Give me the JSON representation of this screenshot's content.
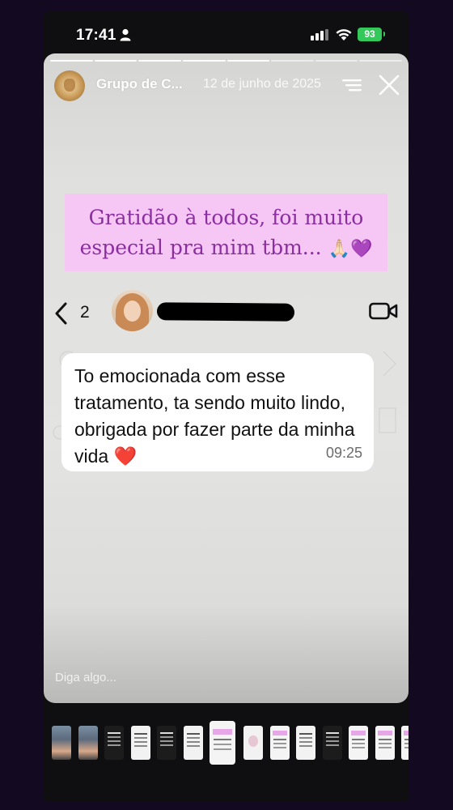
{
  "status_bar": {
    "time": "17:41",
    "battery": "93",
    "battery_color": "#34c759"
  },
  "story": {
    "user": "Grupo de C...",
    "date": "12 de junho de 2025",
    "caption_line1": "Gratidão à todos, foi muito",
    "caption_line2": "especial pra mim tbm...",
    "caption_emoji": "🙏🏻💜",
    "caption_bg": "#f6c7f4",
    "caption_color": "#8a2fa0",
    "reply_placeholder": "Diga algo...",
    "progress_total": 8,
    "progress_done": 5
  },
  "chat": {
    "unread_count": "2",
    "message": "To emocionada com esse tratamento, ta sendo muito lindo, obrigada por fazer parte da minha vida ❤️",
    "time": "09:25"
  },
  "icons": {
    "person": "person-icon",
    "signal": "cellular-signal-icon",
    "wifi": "wifi-icon",
    "menu": "menu-icon",
    "close": "close-icon",
    "back": "chevron-left-icon",
    "video": "video-camera-icon"
  },
  "thumbnails": [
    "photo",
    "photo",
    "dark",
    "white",
    "dark",
    "white",
    "current",
    "faint",
    "pink",
    "white",
    "dark",
    "pink",
    "pink",
    "pink"
  ]
}
